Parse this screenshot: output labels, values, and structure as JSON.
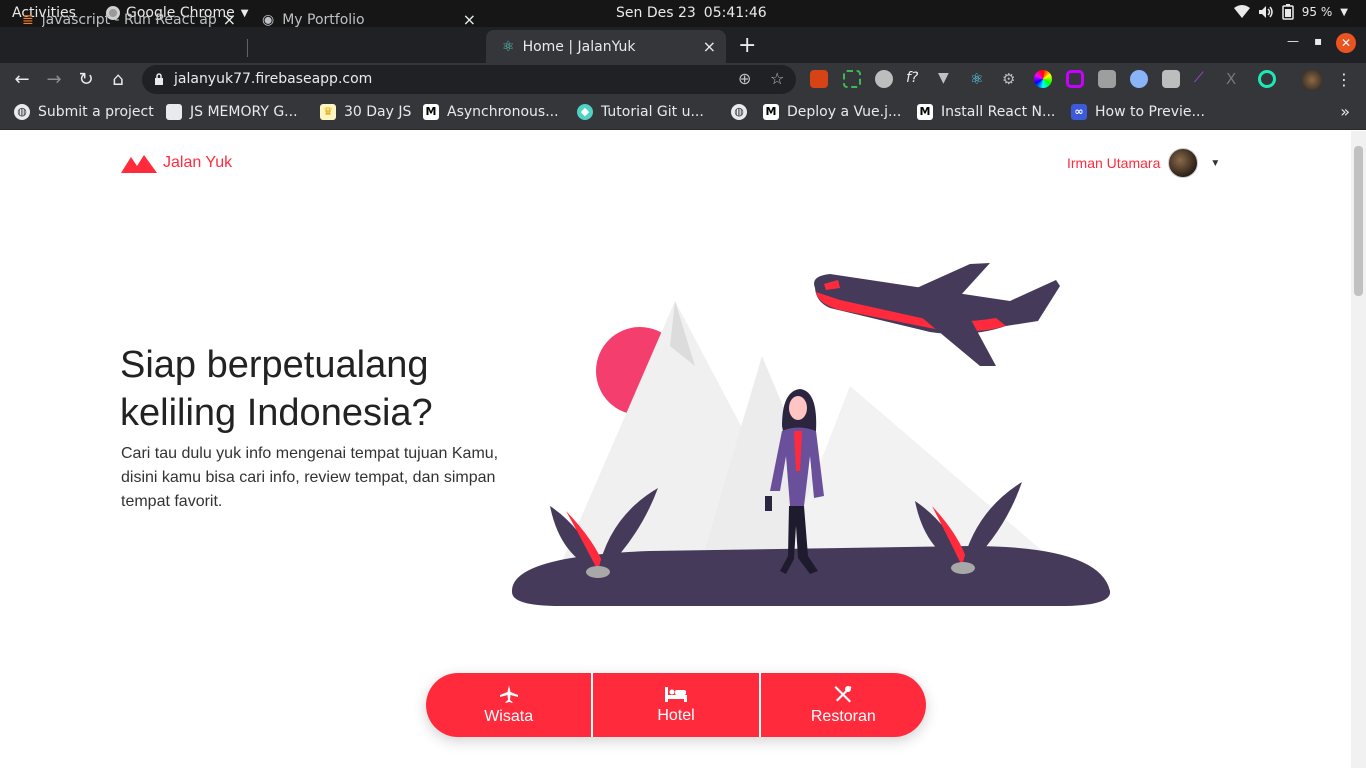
{
  "system": {
    "activities": "Activities",
    "app_name": "Google Chrome",
    "date": "Sen Des 23",
    "time": "05:41:46",
    "battery": "95 %"
  },
  "tabs": [
    {
      "title": "javascript - Run React app",
      "active": false
    },
    {
      "title": "My Portfolio",
      "active": false
    },
    {
      "title": "Home | JalanYuk",
      "active": true
    }
  ],
  "toolbar": {
    "url": "jalanyuk77.firebaseapp.com"
  },
  "bookmarks": [
    {
      "label": "Submit a project",
      "icon": "globe-icon"
    },
    {
      "label": "JS MEMORY G...",
      "icon": "floppy-icon"
    },
    {
      "label": "30 Day JS",
      "icon": "crown-icon"
    },
    {
      "label": "Asynchronous...",
      "icon": "medium-icon"
    },
    {
      "label": "Tutorial  Git u...",
      "icon": "git-icon"
    },
    {
      "label": "",
      "icon": "globe-icon"
    },
    {
      "label": "Deploy a Vue.j...",
      "icon": "medium-icon"
    },
    {
      "label": "Install React N...",
      "icon": "medium-icon"
    },
    {
      "label": "How to Previe...",
      "icon": "infinity-icon"
    }
  ],
  "site": {
    "brand": "Jalan Yuk",
    "user_name": "Irman Utamara",
    "hero_title": "Siap berpetualang keliling Indonesia?",
    "hero_description": "Cari tau dulu yuk info mengenai tempat tujuan Kamu, disini kamu bisa cari info, review tempat, dan simpan tempat favorit.",
    "categories": [
      {
        "label": "Wisata",
        "icon": "airplane-icon"
      },
      {
        "label": "Hotel",
        "icon": "bed-icon"
      },
      {
        "label": "Restoran",
        "icon": "utensils-icon"
      }
    ],
    "colors": {
      "accent": "#ff2b3d",
      "illustration_dark": "#463a5a"
    }
  }
}
